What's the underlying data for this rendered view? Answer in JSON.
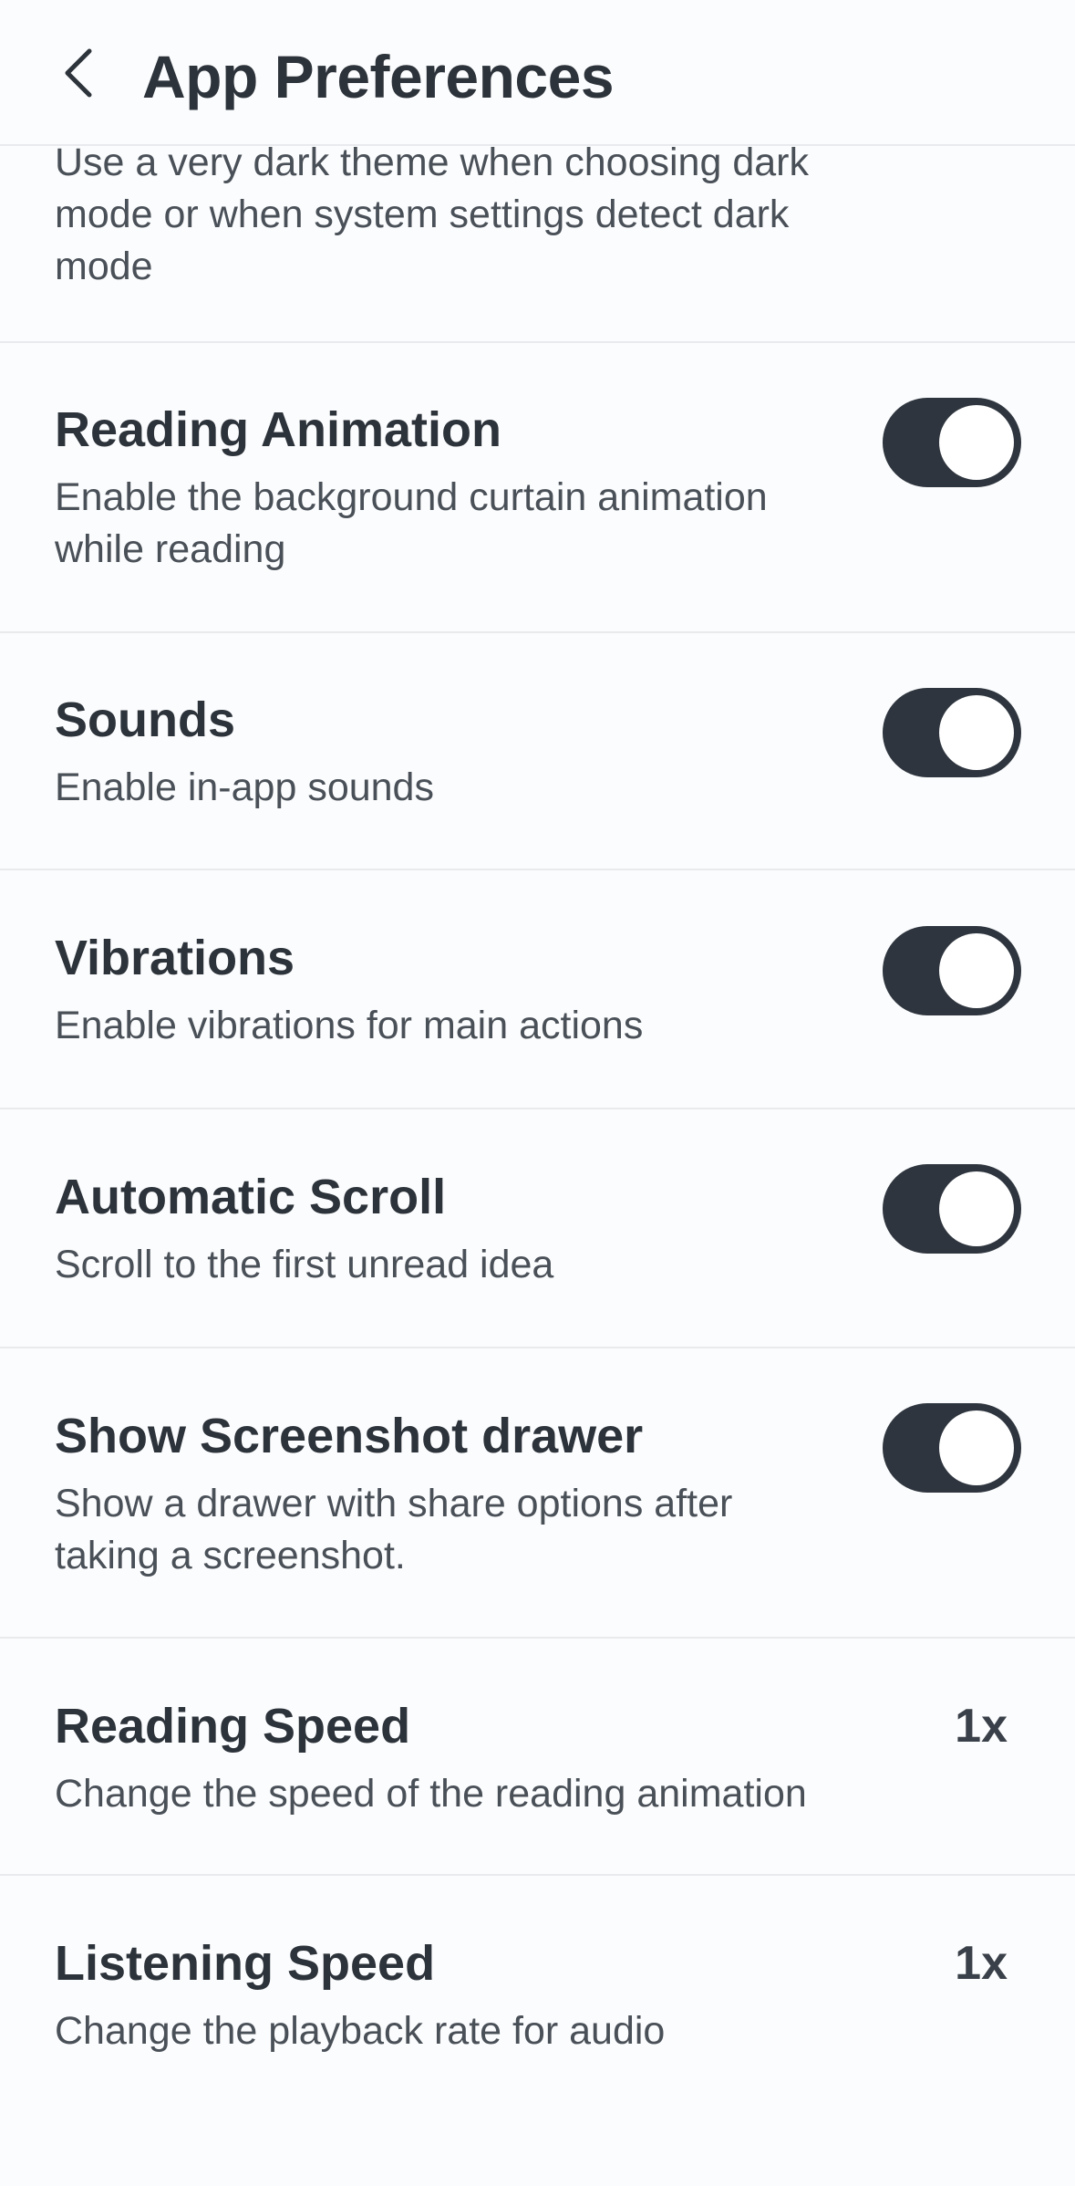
{
  "header": {
    "title": "App Preferences",
    "back_icon": "chevron-left-icon"
  },
  "partial_item": {
    "description": "Use a very dark theme when choosing dark mode or when system settings detect dark mode"
  },
  "settings": [
    {
      "title": "Reading Animation",
      "description": "Enable the background curtain animation while reading",
      "control": "toggle",
      "enabled": true
    },
    {
      "title": "Sounds",
      "description": "Enable in-app sounds",
      "control": "toggle",
      "enabled": true
    },
    {
      "title": "Vibrations",
      "description": "Enable vibrations for main actions",
      "control": "toggle",
      "enabled": true
    },
    {
      "title": "Automatic Scroll",
      "description": "Scroll to the first unread idea",
      "control": "toggle",
      "enabled": true
    },
    {
      "title": "Show Screenshot drawer",
      "description": "Show a drawer with share options after taking a screenshot.",
      "control": "toggle",
      "enabled": true
    },
    {
      "title": "Reading Speed",
      "description": "Change the speed of the reading animation",
      "control": "value",
      "value": "1x"
    },
    {
      "title": "Listening Speed",
      "description": "Change the playback rate for audio",
      "control": "value",
      "value": "1x"
    }
  ],
  "colors": {
    "background": "#fbfcfd",
    "toggle_on": "#2e353e",
    "divider": "#e8eaed",
    "title_text": "#2d333b",
    "body_text": "#4a5058"
  }
}
